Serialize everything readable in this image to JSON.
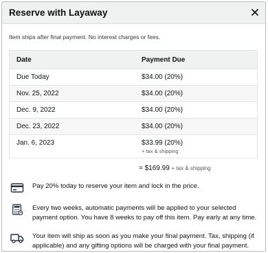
{
  "modal": {
    "title": "Reserve with Layaway",
    "close_icon": "close-icon"
  },
  "intro": "Item ships after final payment. No interest charges or fees.",
  "schedule": {
    "headers": [
      "Date",
      "Payment Due"
    ],
    "rows": [
      {
        "date": "Due Today",
        "amount": "$34.00 (20%)"
      },
      {
        "date": "Nov. 25, 2022",
        "amount": "$34.00 (20%)"
      },
      {
        "date": "Dec. 9, 2022",
        "amount": "$34.00 (20%)"
      },
      {
        "date": "Dec. 23, 2022",
        "amount": "$34.00 (20%)"
      },
      {
        "date": "Jan. 6, 2023",
        "amount": "$33.99 (20%)",
        "note": "+ tax & shipping"
      }
    ]
  },
  "total": {
    "amount": "= $169.99",
    "note": "+ tax & shipping"
  },
  "info": [
    {
      "icon": "credit-card-icon",
      "text": "Pay 20% today to reserve your item and lock in the price."
    },
    {
      "icon": "calculator-icon",
      "text": "Every two weeks, automatic payments will be applied to your selected payment option. You have 8 weeks to pay off this item. Pay early at any time."
    },
    {
      "icon": "truck-icon",
      "text": "Your item will ship as soon as you make your final payment. Tax, shipping (if applicable) and any gifting options will be charged with your final payment."
    }
  ]
}
